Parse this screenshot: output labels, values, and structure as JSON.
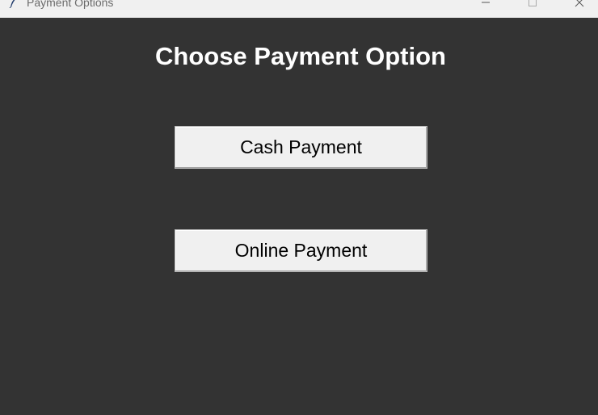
{
  "window": {
    "title": "Payment Options",
    "icon": "feather-icon",
    "controls": {
      "minimize": "minimize-icon",
      "maximize": "maximize-icon",
      "close": "close-icon"
    }
  },
  "main": {
    "heading": "Choose Payment Option",
    "buttons": [
      {
        "label": "Cash Payment"
      },
      {
        "label": "Online Payment"
      }
    ]
  },
  "colors": {
    "background": "#333333",
    "titlebar": "#f0f0f0",
    "button_face": "#f0f0f0",
    "heading_text": "#ffffff"
  }
}
